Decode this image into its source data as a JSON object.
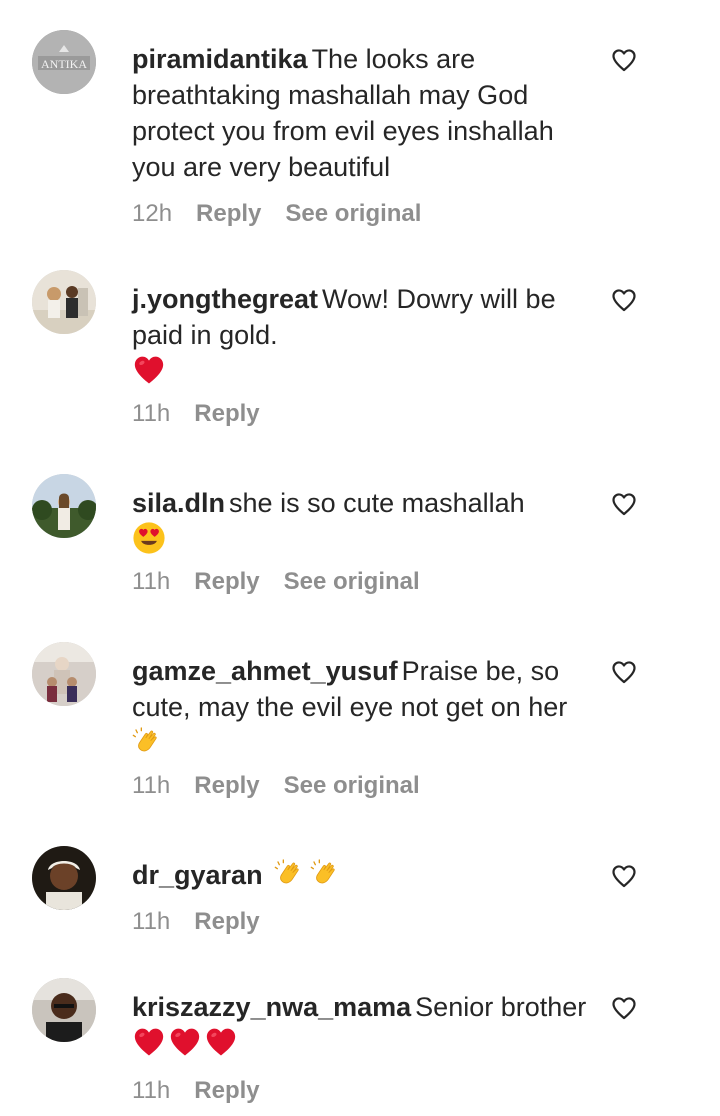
{
  "comments": [
    {
      "username": "piramidantika",
      "text": "The looks are breathtaking mashallah may God protect you from evil eyes inshallah you are very beautiful",
      "emoji": "",
      "avatar_label": "ANTIKA",
      "time": "12h",
      "reply": "Reply",
      "see_original": "See original"
    },
    {
      "username": "j.yongthegreat",
      "text": "Wow! Dowry will be paid in gold.",
      "emoji": "❤️",
      "time": "11h",
      "reply": "Reply",
      "see_original": ""
    },
    {
      "username": "sila.dln",
      "text": "she is so cute mashallah",
      "emoji": "😍",
      "time": "11h",
      "reply": "Reply",
      "see_original": "See original"
    },
    {
      "username": "gamze_ahmet_yusuf",
      "text": "Praise be, so cute, may the evil eye not get on her",
      "emoji": "👏",
      "time": "11h",
      "reply": "Reply",
      "see_original": "See original"
    },
    {
      "username": "dr_gyaran",
      "text": "",
      "emoji": "👏👏",
      "time": "11h",
      "reply": "Reply",
      "see_original": ""
    },
    {
      "username": "kriszazzy_nwa_mama",
      "text": "Senior brother",
      "emoji": "❤️❤️❤️",
      "time": "11h",
      "reply": "Reply",
      "see_original": ""
    }
  ],
  "icons": {
    "like": "heart-outline-icon",
    "red_heart": "red-heart-emoji",
    "clap": "clapping-hands-emoji",
    "heart_eyes": "heart-eyes-emoji"
  },
  "colors": {
    "text": "#262626",
    "meta": "#8e8e8e",
    "red_heart": "#e0102d"
  }
}
